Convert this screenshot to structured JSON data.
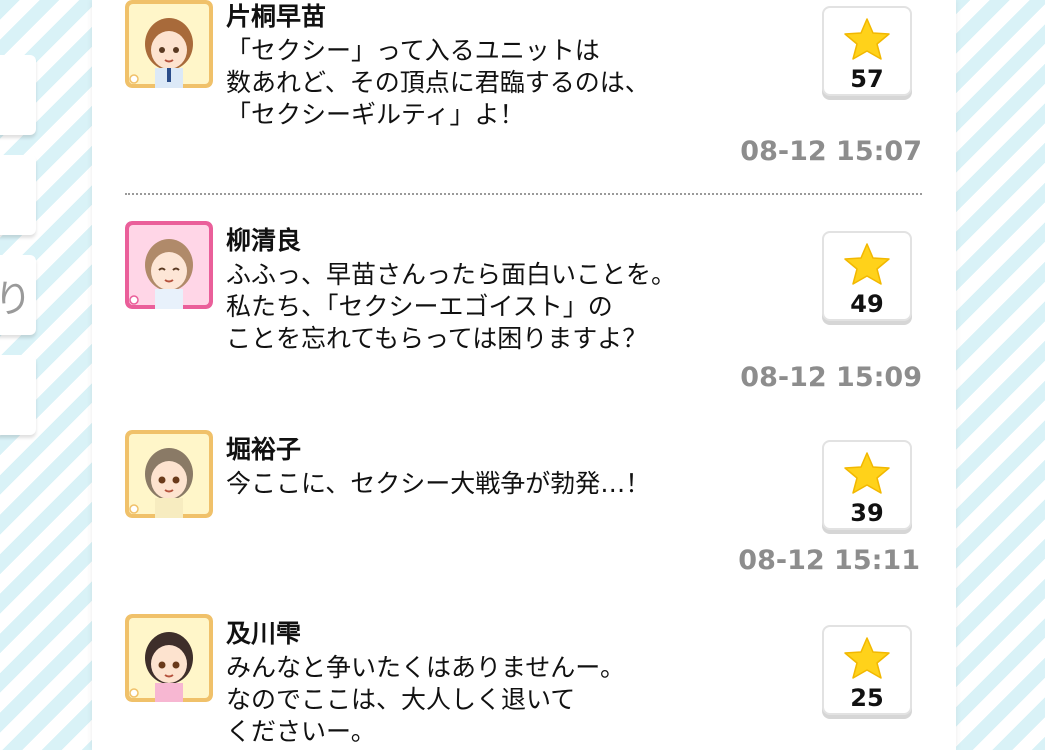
{
  "side_tabs": [
    {
      "label": ""
    },
    {
      "label": ""
    },
    {
      "label": "り"
    },
    {
      "label": ""
    }
  ],
  "posts": [
    {
      "name": "片桐早苗",
      "avatar_icon": "idol-avatar-sanae",
      "frame_color": "#f0c16a",
      "lines": [
        "「セクシー」って入るユニットは",
        "数あれど、その頂点に君臨するのは、",
        "「セクシーギルティ」よ！"
      ],
      "star_count": "57",
      "timestamp": "08-12 15:07"
    },
    {
      "name": "柳清良",
      "avatar_icon": "idol-avatar-seira",
      "frame_color": "#ea5f9a",
      "lines": [
        "ふふっ、早苗さんったら面白いことを。",
        "私たち、「セクシーエゴイスト」の",
        "ことを忘れてもらっては困りますよ？"
      ],
      "star_count": "49",
      "timestamp": "08-12 15:09"
    },
    {
      "name": "堀裕子",
      "avatar_icon": "idol-avatar-yuko",
      "frame_color": "#f0c16a",
      "lines": [
        "今ここに、セクシー大戦争が勃発…！"
      ],
      "star_count": "39",
      "timestamp": "08-12 15:11"
    },
    {
      "name": "及川雫",
      "avatar_icon": "idol-avatar-shizuku",
      "frame_color": "#f0c16a",
      "lines": [
        "みんなと争いたくはありませんー。",
        "なのでここは、大人しく退いて",
        "くださいー。"
      ],
      "star_count": "25",
      "timestamp": ""
    }
  ]
}
